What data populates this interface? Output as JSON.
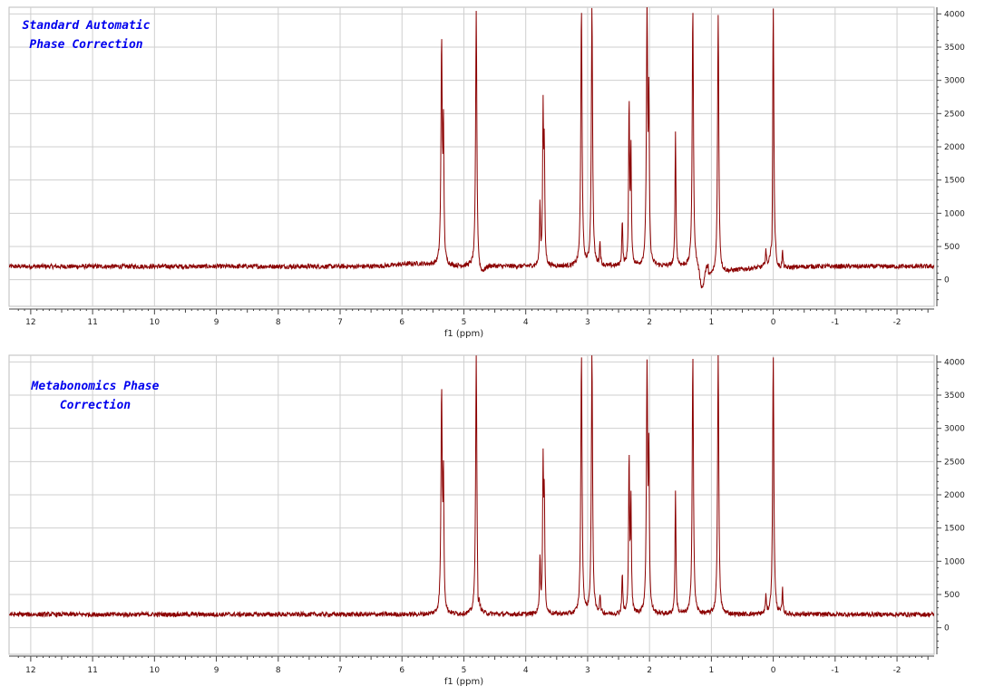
{
  "chart_data": [
    {
      "type": "line",
      "title": "Standard Automatic Phase Correction",
      "xlabel": "f1 (ppm)",
      "ylabel": "",
      "x_reversed": true,
      "xlim": [
        12.35,
        -2.6
      ],
      "ylim": [
        -400,
        4100
      ],
      "x_ticks": [
        12,
        11,
        10,
        9,
        8,
        7,
        6,
        5,
        4,
        3,
        2,
        1,
        0,
        -1,
        -2
      ],
      "y_ticks": [
        0,
        500,
        1000,
        1500,
        2000,
        2500,
        3000,
        3500,
        4000
      ],
      "y_axis_position": "right",
      "grid": true,
      "line_color": "#8b0000",
      "baseline": 200,
      "baseline_artifacts": "dispersive distortions near 4.8, 1.2 and 0 ppm",
      "peaks": [
        {
          "x": 5.36,
          "y": 3520
        },
        {
          "x": 5.33,
          "y": 2100
        },
        {
          "x": 4.8,
          "y": 4100
        },
        {
          "x": 3.77,
          "y": 1100
        },
        {
          "x": 3.72,
          "y": 2450
        },
        {
          "x": 3.7,
          "y": 1850
        },
        {
          "x": 3.1,
          "y": 4100
        },
        {
          "x": 2.93,
          "y": 4100
        },
        {
          "x": 2.8,
          "y": 550
        },
        {
          "x": 2.44,
          "y": 900
        },
        {
          "x": 2.33,
          "y": 2650
        },
        {
          "x": 2.3,
          "y": 1900
        },
        {
          "x": 2.04,
          "y": 4000
        },
        {
          "x": 2.01,
          "y": 2500
        },
        {
          "x": 1.58,
          "y": 2250
        },
        {
          "x": 1.3,
          "y": 4100
        },
        {
          "x": 0.89,
          "y": 4100
        },
        {
          "x": 0.12,
          "y": 450
        },
        {
          "x": 0.0,
          "y": 4100
        },
        {
          "x": -0.15,
          "y": 450
        }
      ]
    },
    {
      "type": "line",
      "title": "Metabonomics Phase Correction",
      "xlabel": "f1 (ppm)",
      "ylabel": "",
      "x_reversed": true,
      "xlim": [
        12.35,
        -2.6
      ],
      "ylim": [
        -400,
        4100
      ],
      "x_ticks": [
        12,
        11,
        10,
        9,
        8,
        7,
        6,
        5,
        4,
        3,
        2,
        1,
        0,
        -1,
        -2
      ],
      "y_ticks": [
        0,
        500,
        1000,
        1500,
        2000,
        2500,
        3000,
        3500,
        4000
      ],
      "y_axis_position": "right",
      "grid": true,
      "line_color": "#8b0000",
      "baseline": 200,
      "baseline_artifacts": "flat baseline",
      "peaks": [
        {
          "x": 5.36,
          "y": 3520
        },
        {
          "x": 5.33,
          "y": 2100
        },
        {
          "x": 4.8,
          "y": 4100
        },
        {
          "x": 3.77,
          "y": 1050
        },
        {
          "x": 3.72,
          "y": 2420
        },
        {
          "x": 3.7,
          "y": 1850
        },
        {
          "x": 3.1,
          "y": 4100
        },
        {
          "x": 2.93,
          "y": 4100
        },
        {
          "x": 2.8,
          "y": 480
        },
        {
          "x": 2.44,
          "y": 820
        },
        {
          "x": 2.33,
          "y": 2600
        },
        {
          "x": 2.3,
          "y": 1850
        },
        {
          "x": 2.04,
          "y": 3850
        },
        {
          "x": 2.01,
          "y": 2450
        },
        {
          "x": 1.58,
          "y": 2080
        },
        {
          "x": 1.3,
          "y": 4100
        },
        {
          "x": 0.89,
          "y": 4100
        },
        {
          "x": 0.12,
          "y": 470
        },
        {
          "x": 0.0,
          "y": 4100
        },
        {
          "x": -0.15,
          "y": 560
        }
      ]
    }
  ],
  "panels": {
    "top": {
      "title_line1": "Standard Automatic",
      "title_line2": "Phase Correction"
    },
    "bottom": {
      "title_line1": "Metabonomics Phase",
      "title_line2": "Correction"
    }
  }
}
